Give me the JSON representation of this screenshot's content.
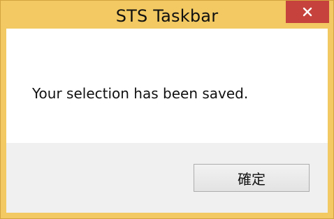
{
  "window": {
    "title": "STS Taskbar",
    "close_icon": "close-icon",
    "colors": {
      "frame": "#f2c962",
      "close_button": "#c6433d"
    }
  },
  "dialog": {
    "message": "Your selection has been saved.",
    "ok_label": "確定"
  }
}
